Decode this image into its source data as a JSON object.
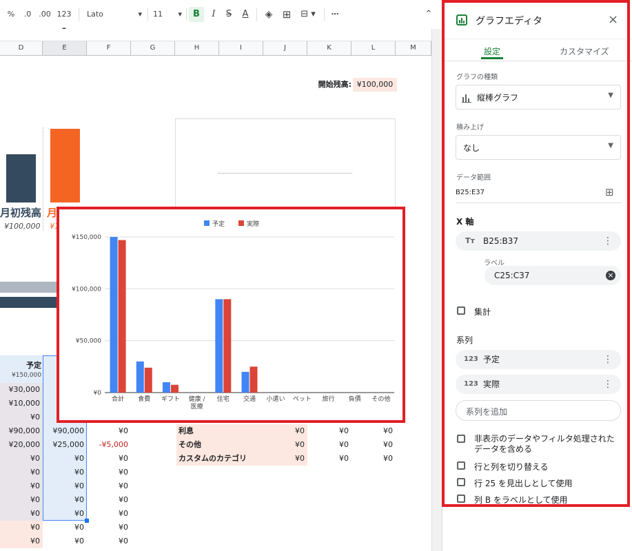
{
  "toolbar": {
    "percent": "%",
    "dec_less": ".0",
    "dec_more": ".00",
    "num_format": "123",
    "font": "Lato",
    "size": "11",
    "bold": "B",
    "italic": "I",
    "strike": "S",
    "textcolor": "A",
    "more": "⋯"
  },
  "columns": [
    "D",
    "E",
    "F",
    "G",
    "H",
    "I",
    "J",
    "K",
    "L",
    "M"
  ],
  "sheet": {
    "start_balance_label": "開始残高:",
    "start_balance_value": "¥100,000",
    "left_label": "月初残高",
    "left_label2": "月",
    "left_value": "¥100,000",
    "left_value2": "¥1",
    "budget_header": "予定",
    "budget_sub": "¥150,000",
    "colD": [
      "¥30,000",
      "¥10,000",
      "¥0",
      "¥90,000",
      "¥20,000",
      "¥0",
      "¥0",
      "¥0",
      "¥0",
      "¥0",
      "¥0",
      "¥0"
    ],
    "colE": [
      "",
      "",
      "",
      "¥90,000",
      "¥25,000",
      "¥0",
      "¥0",
      "¥0",
      "¥0",
      "¥0",
      "¥0",
      "¥0"
    ],
    "colF": [
      "",
      "",
      "",
      "¥0",
      "-¥5,000",
      "¥0",
      "¥0",
      "¥0",
      "¥0",
      "¥0",
      "¥0",
      "¥0"
    ],
    "right_rows": [
      {
        "name": "利息",
        "j": "¥0",
        "k": "¥0",
        "l": "¥0"
      },
      {
        "name": "その他",
        "j": "¥0",
        "k": "¥0",
        "l": "¥0"
      },
      {
        "name": "カスタムのカテゴリ",
        "j": "¥0",
        "k": "¥0",
        "l": "¥0"
      }
    ]
  },
  "chart_data": {
    "type": "bar",
    "categories": [
      "合計",
      "食費",
      "ギフト",
      "健康 / 医療",
      "住宅",
      "交通",
      "小遣い",
      "ペット",
      "旅行",
      "負債",
      "その他"
    ],
    "series": [
      {
        "name": "予定",
        "color": "#4285f4",
        "values": [
          150000,
          30000,
          10000,
          0,
          90000,
          20000,
          0,
          0,
          0,
          0,
          0
        ]
      },
      {
        "name": "実際",
        "color": "#db4437",
        "values": [
          147000,
          24000,
          7500,
          0,
          90000,
          25000,
          0,
          0,
          0,
          0,
          0
        ]
      }
    ],
    "ylim": [
      0,
      150000
    ],
    "yticks": [
      "¥0",
      "¥50,000",
      "¥100,000",
      "¥150,000"
    ],
    "legend_position": "top"
  },
  "panel": {
    "title": "グラフエディタ",
    "tab_setup": "設定",
    "tab_customize": "カスタマイズ",
    "chart_type_label": "グラフの種類",
    "chart_type_value": "縦棒グラフ",
    "stacking_label": "積み上げ",
    "stacking_value": "なし",
    "data_range_label": "データ範囲",
    "data_range_value": "B25:E37",
    "x_axis_label": "X 軸",
    "x_axis_value": "B25:B37",
    "label_label": "ラベル",
    "label_value": "C25:C37",
    "aggregate": "集計",
    "series_label": "系列",
    "series": [
      "予定",
      "実際"
    ],
    "add_series": "系列を追加",
    "opt_hidden": "非表示のデータやフィルタ処理されたデータを含める",
    "opt_switch": "行と列を切り替える",
    "opt_header": "行 25 を見出しとして使用",
    "opt_labels": "列 B をラベルとして使用"
  }
}
